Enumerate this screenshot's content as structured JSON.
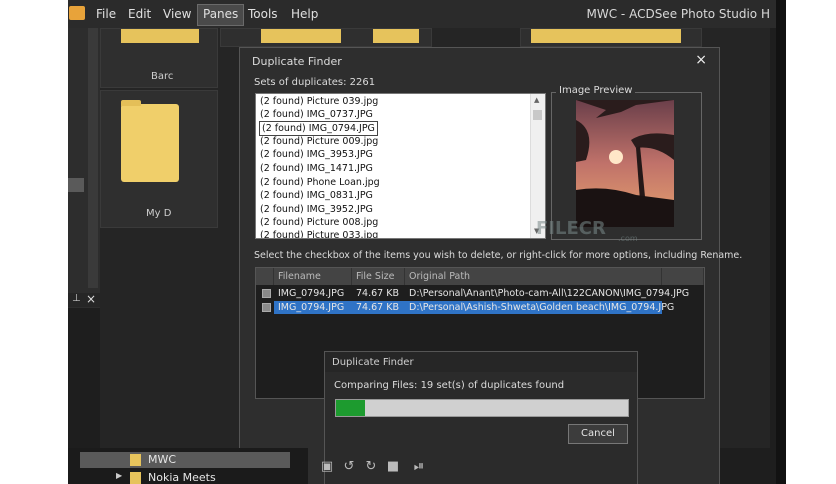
{
  "app": {
    "title": "MWC - ACDSee Photo Studio H",
    "menu": [
      "File",
      "Edit",
      "View",
      "Panes",
      "Tools",
      "Help"
    ],
    "active_menu": "Panes"
  },
  "left_panel": {
    "pin_icon": "pin-icon",
    "close_label": "×"
  },
  "browser": {
    "folder_labels": [
      "Barc",
      "My D"
    ]
  },
  "duplicate_dialog": {
    "title": "Duplicate Finder",
    "close_label": "×",
    "sets_label": "Sets of duplicates: 2261",
    "list": [
      "(2 found) Picture 039.jpg",
      "(2 found) IMG_0737.JPG",
      "(2 found) IMG_0794.JPG",
      "(2 found) Picture 009.jpg",
      "(2 found) IMG_3953.JPG",
      "(2 found) IMG_1471.JPG",
      "(2 found) Phone Loan.jpg",
      "(2 found) IMG_0831.JPG",
      "(2 found) IMG_3952.JPG",
      "(2 found) Picture 008.jpg",
      "(2 found) Picture 033.jpg"
    ],
    "selected_index": 2,
    "preview_label": "Image Preview",
    "instruction": "Select the checkbox of the items you wish to delete, or right-click for more options, including Rename.",
    "table": {
      "columns": [
        "Filename",
        "File Size",
        "Original Path"
      ],
      "rows": [
        {
          "filename": "IMG_0794.JPG",
          "size": "74.67 KB",
          "path": "D:\\Personal\\Anant\\Photo-cam-All\\122CANON\\IMG_0794.JPG",
          "selected": false
        },
        {
          "filename": "IMG_0794.JPG",
          "size": "74.67 KB",
          "path": "D:\\Personal\\Ashish-Shweta\\Golden beach\\IMG_0794.JPG",
          "selected": true
        }
      ]
    }
  },
  "progress_dialog": {
    "title": "Duplicate Finder",
    "status": "Comparing Files: 19 set(s) of duplicates found",
    "progress": 0.1,
    "cancel_label": "Cancel",
    "progress_color": "#1d9b2f"
  },
  "watermark": {
    "text": "FILECR",
    "sub": ".com"
  },
  "tree": {
    "items": [
      "MWC",
      "Nokia Meets"
    ]
  },
  "colors": {
    "selection": "#2f73c6",
    "folder": "#e6c35c"
  }
}
